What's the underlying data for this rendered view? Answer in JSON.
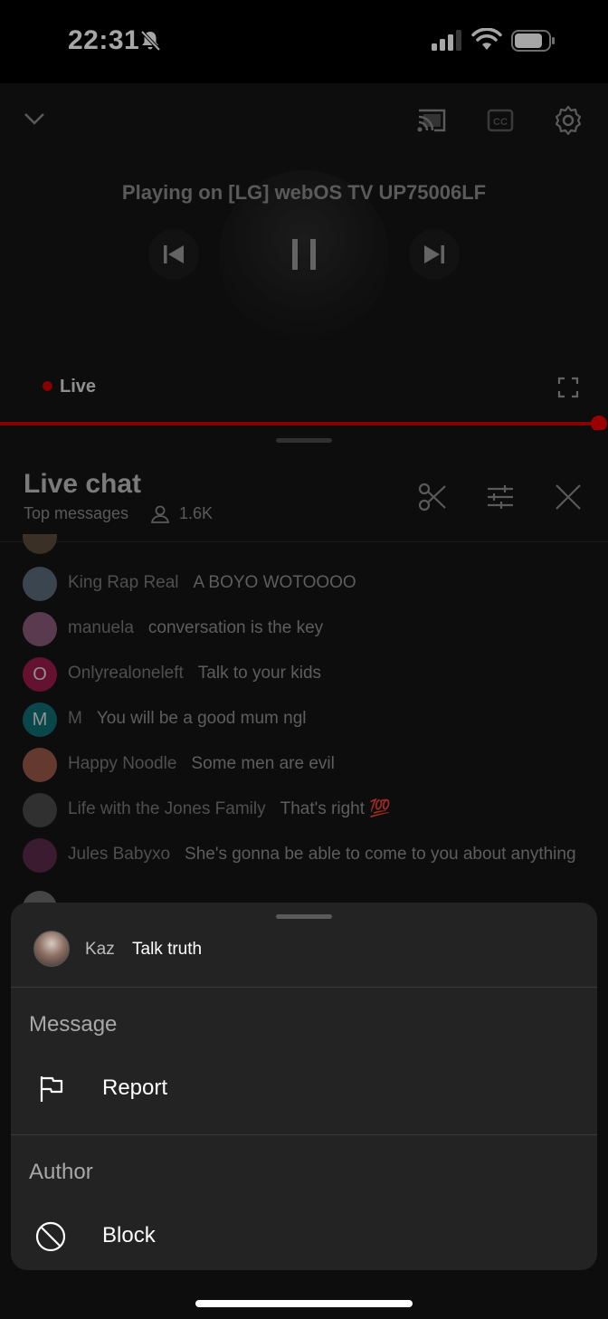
{
  "status_bar": {
    "time": "22:31"
  },
  "player": {
    "cast_title": "Playing on [LG] webOS TV UP75006LF",
    "live_label": "Live"
  },
  "chat": {
    "title": "Live chat",
    "subtitle": "Top messages",
    "viewer_count": "1.6K",
    "messages": [
      {
        "author": "King Rap Real",
        "text": "A BOYO WOTOOOO",
        "avatar_letter": "",
        "avatar_color": "#5a6b7a"
      },
      {
        "author": "manuela",
        "text": "conversation is the key",
        "avatar_letter": "",
        "avatar_color": "#8a5a7a"
      },
      {
        "author": "Onlyrealoneleft",
        "text": "Talk to your kids",
        "avatar_letter": "O",
        "avatar_color": "#9b1c4a"
      },
      {
        "author": "M",
        "text": "You will be a good mum ngl",
        "avatar_letter": "M",
        "avatar_color": "#0f6e74"
      },
      {
        "author": "Happy Noodle",
        "text": "Some men are evil",
        "avatar_letter": "",
        "avatar_color": "#9a5a4a"
      },
      {
        "author": "Life with the Jones Family",
        "text": "That's right 💯",
        "avatar_letter": "",
        "avatar_color": "#4a4a4a"
      },
      {
        "author": "Jules Babyxo",
        "text": "She's gonna be able to come to you about anything",
        "avatar_letter": "",
        "avatar_color": "#5a2a4a"
      }
    ]
  },
  "sheet": {
    "author": "Kaz",
    "message": "Talk truth",
    "section_message": "Message",
    "report_label": "Report",
    "section_author": "Author",
    "block_label": "Block"
  },
  "colors": {
    "live_red": "#cc0000",
    "background": "#000000",
    "sheet_bg": "#232323"
  },
  "icons": {
    "collapse": "chevron-down-icon",
    "cast": "cast-icon",
    "captions": "cc-icon",
    "settings": "gear-icon",
    "previous": "skip-previous-icon",
    "pause": "pause-icon",
    "next": "skip-next-icon",
    "fullscreen": "fullscreen-icon",
    "clip": "scissors-icon",
    "filter": "tune-icon",
    "close": "close-icon",
    "viewers": "person-icon",
    "report": "flag-icon",
    "block": "block-icon"
  }
}
